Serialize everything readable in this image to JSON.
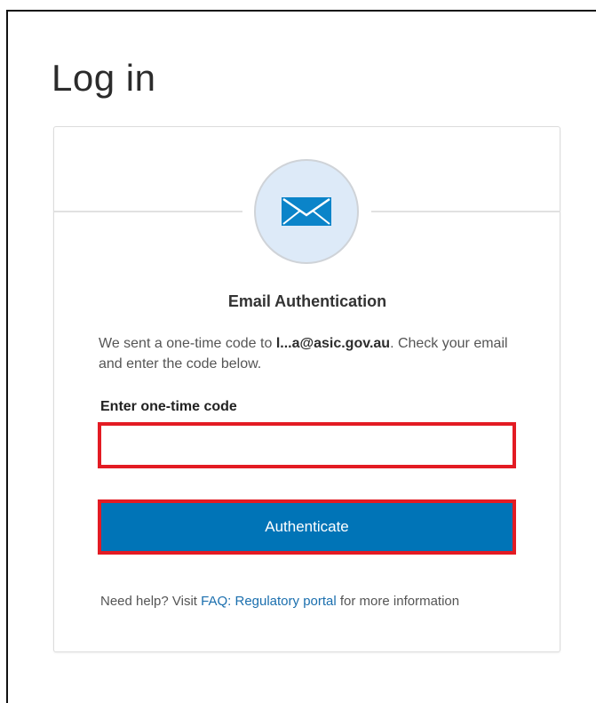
{
  "page": {
    "title": "Log in"
  },
  "card": {
    "icon": "envelope-icon",
    "heading": "Email Authentication",
    "message_prefix": "We sent a one-time code to ",
    "email": "l...a@asic.gov.au",
    "message_suffix": ". Check your email and enter the code below.",
    "code_label": "Enter one-time code",
    "code_value": "",
    "button_label": "Authenticate",
    "help_prefix": "Need help? Visit ",
    "help_link": "FAQ: Regulatory portal",
    "help_suffix": " for more information"
  },
  "colors": {
    "accent": "#0074b7",
    "highlight": "#e31b23",
    "link": "#1b6fae",
    "icon_bg": "#ddeaf8"
  }
}
